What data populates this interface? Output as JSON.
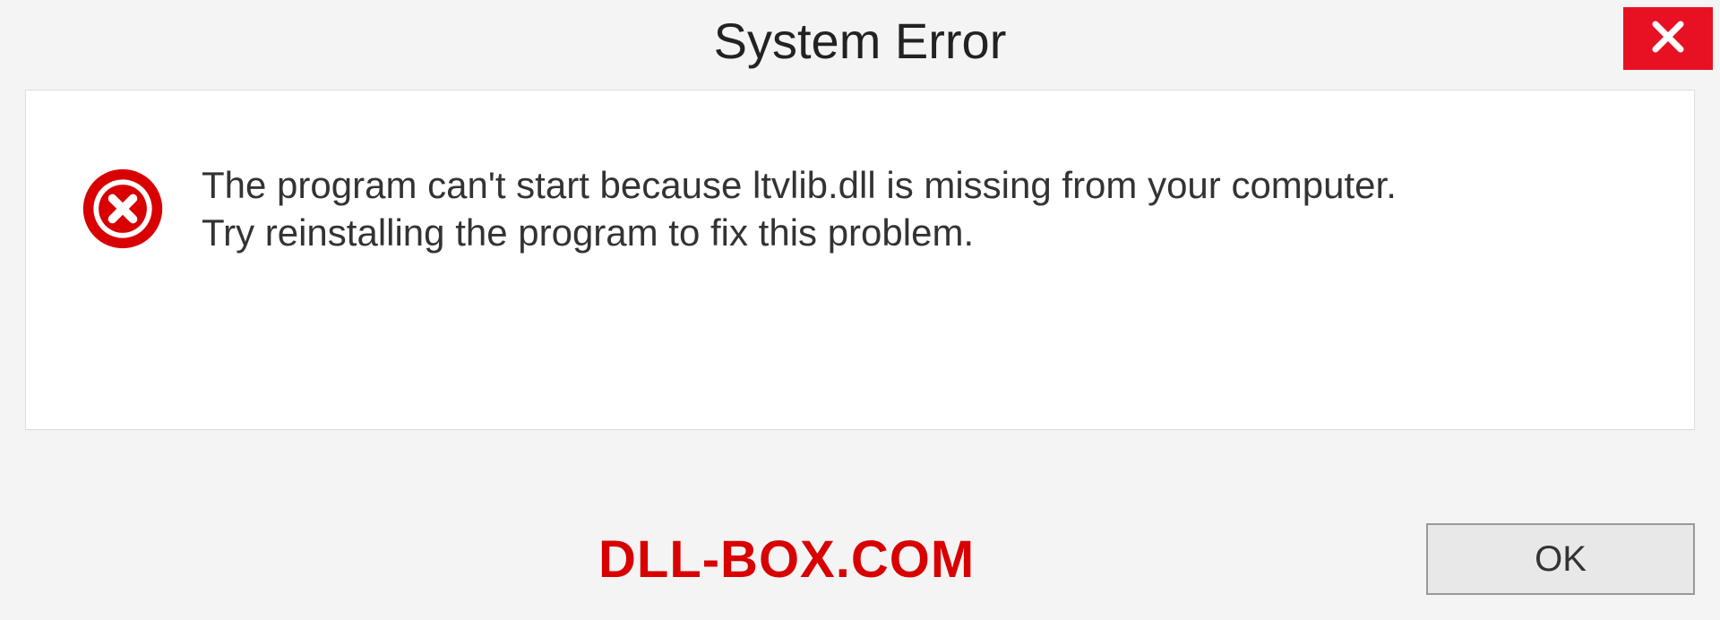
{
  "dialog": {
    "title": "System Error",
    "message_line1": "The program can't start because ltvlib.dll is missing from your computer.",
    "message_line2": "Try reinstalling the program to fix this problem.",
    "ok_label": "OK"
  },
  "watermark": "DLL-BOX.COM"
}
